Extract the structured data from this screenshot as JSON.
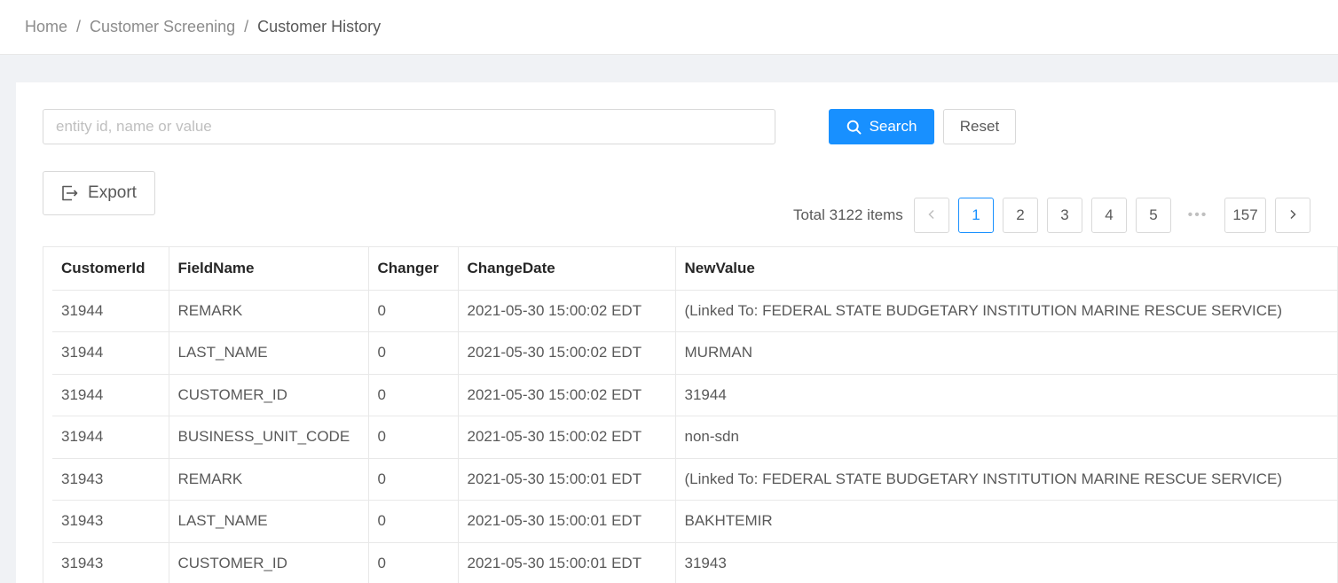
{
  "breadcrumb": {
    "items": [
      "Home",
      "Customer Screening"
    ],
    "separator": "/",
    "current": "Customer History"
  },
  "search": {
    "placeholder": "entity id, name or value",
    "value": "",
    "search_label": "Search",
    "reset_label": "Reset"
  },
  "toolbar": {
    "export_label": "Export"
  },
  "pagination": {
    "total_text": "Total 3122 items",
    "pages": [
      "1",
      "2",
      "3",
      "4",
      "5"
    ],
    "ellipsis": "•••",
    "last_page": "157",
    "current": "1"
  },
  "table": {
    "columns": [
      "CustomerId",
      "FieldName",
      "Changer",
      "ChangeDate",
      "NewValue"
    ],
    "rows": [
      [
        "31944",
        "REMARK",
        "0",
        "2021-05-30 15:00:02 EDT",
        "(Linked To: FEDERAL STATE BUDGETARY INSTITUTION MARINE RESCUE SERVICE)"
      ],
      [
        "31944",
        "LAST_NAME",
        "0",
        "2021-05-30 15:00:02 EDT",
        "MURMAN"
      ],
      [
        "31944",
        "CUSTOMER_ID",
        "0",
        "2021-05-30 15:00:02 EDT",
        "31944"
      ],
      [
        "31944",
        "BUSINESS_UNIT_CODE",
        "0",
        "2021-05-30 15:00:02 EDT",
        "non-sdn"
      ],
      [
        "31943",
        "REMARK",
        "0",
        "2021-05-30 15:00:01 EDT",
        "(Linked To: FEDERAL STATE BUDGETARY INSTITUTION MARINE RESCUE SERVICE)"
      ],
      [
        "31943",
        "LAST_NAME",
        "0",
        "2021-05-30 15:00:01 EDT",
        "BAKHTEMIR"
      ],
      [
        "31943",
        "CUSTOMER_ID",
        "0",
        "2021-05-30 15:00:01 EDT",
        "31943"
      ]
    ]
  },
  "colors": {
    "primary": "#1890ff",
    "border": "#d9d9d9",
    "background": "#f0f2f5"
  }
}
